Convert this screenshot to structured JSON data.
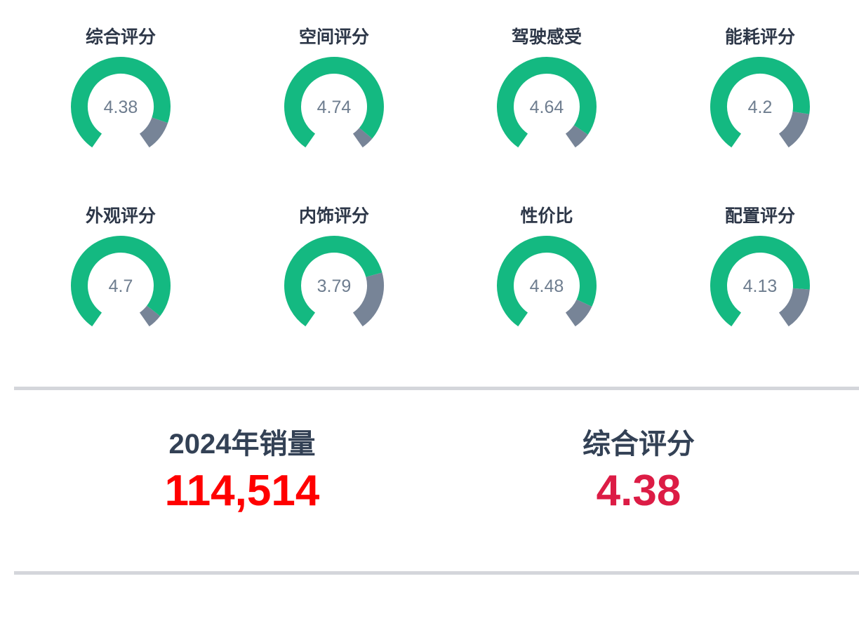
{
  "chart_data": {
    "type": "gauge",
    "max": 5,
    "colors": {
      "filled": "#14b981",
      "remaining": "#778497"
    },
    "items": [
      {
        "label": "综合评分",
        "value": 4.38
      },
      {
        "label": "空间评分",
        "value": 4.74
      },
      {
        "label": "驾驶感受",
        "value": 4.64
      },
      {
        "label": "能耗评分",
        "value": 4.2
      },
      {
        "label": "外观评分",
        "value": 4.7
      },
      {
        "label": "内饰评分",
        "value": 3.79
      },
      {
        "label": "性价比",
        "value": 4.48
      },
      {
        "label": "配置评分",
        "value": 4.13
      }
    ]
  },
  "summary": {
    "sales": {
      "label": "2024年销量",
      "value": "114,514",
      "color": "#ff0000"
    },
    "score": {
      "label": "综合评分",
      "value": "4.38",
      "color": "#dc1c45"
    }
  }
}
